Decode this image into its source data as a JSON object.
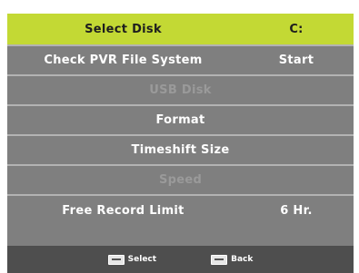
{
  "menu": {
    "header": {
      "label": "Select Disk",
      "value": "C:"
    },
    "items": [
      {
        "label": "Check PVR File System",
        "value": "Start",
        "enabled": true
      },
      {
        "label": "USB Disk",
        "value": "",
        "enabled": false
      },
      {
        "label": "Format",
        "value": "",
        "enabled": true
      },
      {
        "label": "Timeshift Size",
        "value": "",
        "enabled": true
      },
      {
        "label": "Speed",
        "value": "",
        "enabled": false
      },
      {
        "label": "Free Record Limit",
        "value": "6 Hr.",
        "enabled": true
      }
    ]
  },
  "footer": {
    "select_icon": "ok-key-icon",
    "select_label": "Select",
    "back_icon": "menu-key-icon",
    "back_label": "Back"
  },
  "colors": {
    "highlight": "#c3d934",
    "panel": "#7f7f7f",
    "footer": "#4e4e4e"
  }
}
